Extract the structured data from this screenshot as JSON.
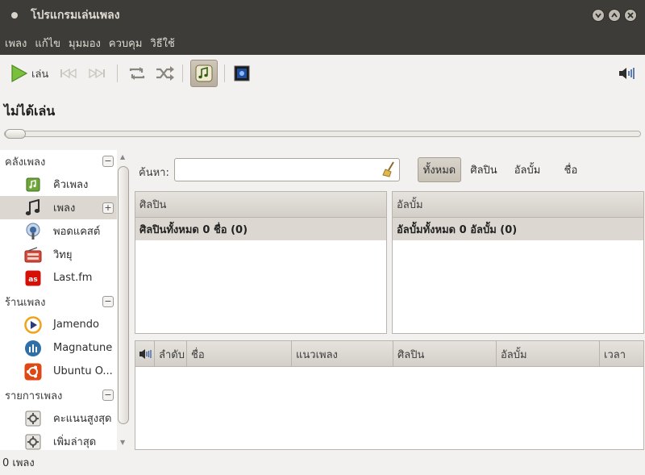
{
  "window": {
    "title": "โปรแกรมเล่นเพลง"
  },
  "menu": [
    "เพลง",
    "แก้ไข",
    "มุมมอง",
    "ควบคุม",
    "วิธีใช้"
  ],
  "toolbar": {
    "play_label": "เล่น"
  },
  "now_playing": "ไม่ได้เล่น",
  "sidebar": {
    "sections": [
      {
        "label": "คลังเพลง",
        "toggle": "−",
        "items": [
          {
            "label": "คิวเพลง",
            "icon": "queue-icon"
          },
          {
            "label": "เพลง",
            "icon": "music-note-icon",
            "selected": true,
            "add": "+"
          },
          {
            "label": "พอดแคสต์",
            "icon": "podcast-icon"
          },
          {
            "label": "วิทยุ",
            "icon": "radio-icon"
          },
          {
            "label": "Last.fm",
            "icon": "lastfm-icon"
          }
        ]
      },
      {
        "label": "ร้านเพลง",
        "toggle": "−",
        "items": [
          {
            "label": "Jamendo",
            "icon": "jamendo-icon"
          },
          {
            "label": "Magnatune",
            "icon": "magnatune-icon"
          },
          {
            "label": "Ubuntu O...",
            "icon": "ubuntu-one-icon"
          }
        ]
      },
      {
        "label": "รายการเพลง",
        "toggle": "−",
        "items": [
          {
            "label": "คะแนนสูงสุด",
            "icon": "smart-playlist-icon"
          },
          {
            "label": "เพิ่มล่าสุด",
            "icon": "smart-playlist-icon"
          }
        ]
      }
    ]
  },
  "browser": {
    "search_label": "ค้นหา:",
    "search_value": "",
    "filters": [
      {
        "label": "ทั้งหมด",
        "active": true
      },
      {
        "label": "ศิลปิน",
        "active": false
      },
      {
        "label": "อัลบั้ม",
        "active": false
      },
      {
        "label": "ชื่อ",
        "active": false
      }
    ],
    "artist_pane": {
      "header": "ศิลปิน",
      "row": "ศิลปินทั้งหมด 0 ชื่อ (0)"
    },
    "album_pane": {
      "header": "อัลบั้ม",
      "row": "อัลบั้มทั้งหมด 0 อัลบั้ม (0)"
    },
    "track_columns": [
      "ลำดับ",
      "ชื่อ",
      "แนวเพลง",
      "ศิลปิน",
      "อัลบั้ม",
      "เวลา"
    ]
  },
  "status": "0 เพลง",
  "colors": {
    "titlebar": "#3d3c38",
    "play_green": "#5aa02c",
    "selected_row": "#dcd8d1"
  }
}
